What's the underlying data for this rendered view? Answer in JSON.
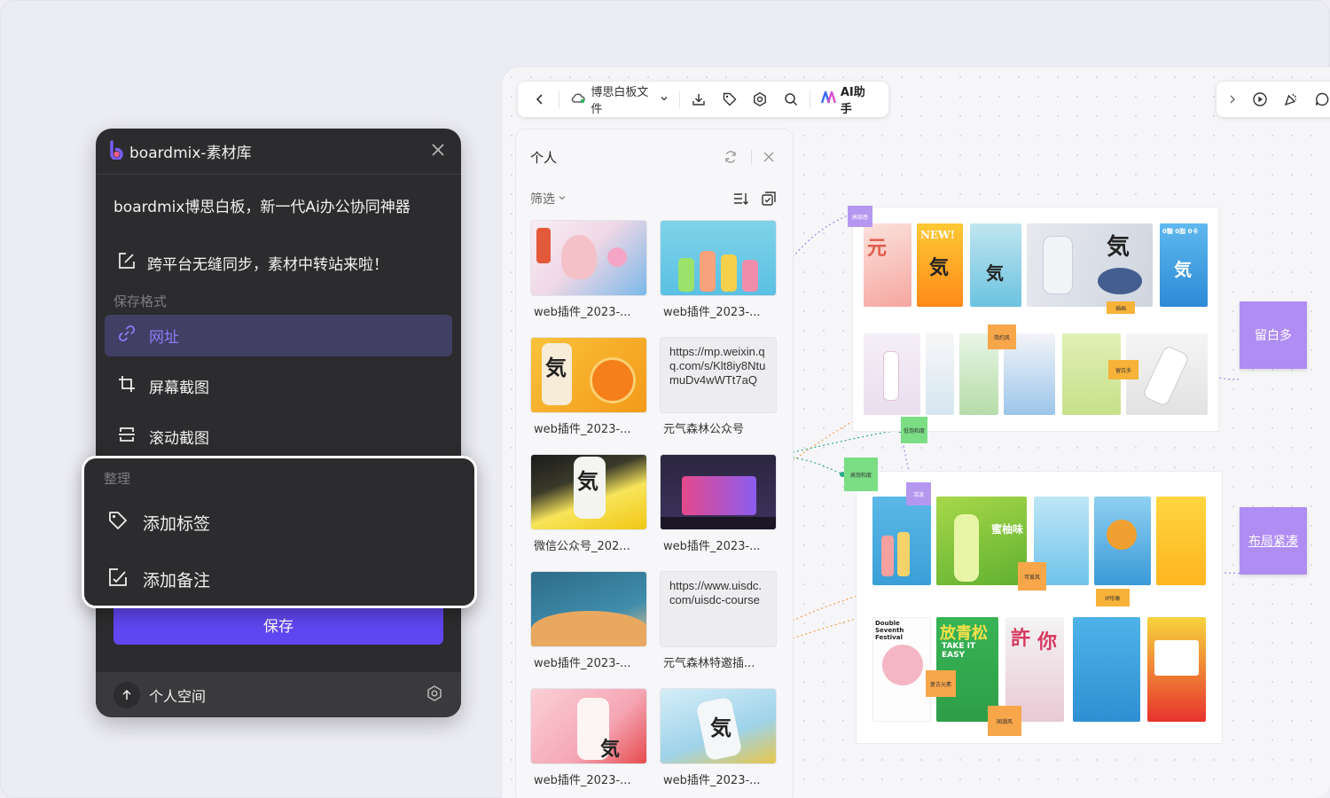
{
  "toolbar": {
    "file_name": "博思白板文件",
    "ai_label": "AI助手"
  },
  "personal_panel": {
    "title": "个人",
    "filter_label": "筛选",
    "cards": [
      {
        "label": "web插件_2023-...",
        "type": "image",
        "colors": [
          "#f4e6ef",
          "#7bb8e8"
        ]
      },
      {
        "label": "web插件_2023-...",
        "type": "image",
        "colors": [
          "#7fd3e9",
          "#f7c0a0"
        ]
      },
      {
        "label": "web插件_2023-...",
        "type": "image",
        "colors": [
          "#f3b233",
          "#f7e6c9"
        ]
      },
      {
        "label": "元气森林公众号",
        "type": "url",
        "url_text": "https://mp.weixin.qq.com/s/Klt8iy8NtumuDv4wWTt7aQ"
      },
      {
        "label": "微信公众号_202...",
        "type": "image",
        "colors": [
          "#f7e55a",
          "#1c1c1c"
        ]
      },
      {
        "label": "web插件_2023-...",
        "type": "image",
        "colors": [
          "#2a2540",
          "#e6498c"
        ]
      },
      {
        "label": "web插件_2023-...",
        "type": "image",
        "colors": [
          "#2e6c8a",
          "#f0c48a"
        ]
      },
      {
        "label": "元气森林特邀插...",
        "type": "url",
        "url_text": "https://www.uisdc.com/uisdc-course"
      },
      {
        "label": "web插件_2023-...",
        "type": "image",
        "colors": [
          "#f5a6b5",
          "#e54b4b"
        ]
      },
      {
        "label": "web插件_2023-...",
        "type": "image",
        "colors": [
          "#bfe4f2",
          "#e8c74a"
        ]
      }
    ]
  },
  "material": {
    "title": "boardmix-素材库",
    "subtitle": "boardmix博思白板，新一代Ai办公协同神器",
    "sync_text": "跨平台无缝同步，素材中转站来啦！",
    "save_format_label": "保存格式",
    "formats": [
      {
        "label": "网址",
        "icon": "link-icon",
        "active": true
      },
      {
        "label": "屏幕截图",
        "icon": "crop-icon",
        "active": false
      },
      {
        "label": "滚动截图",
        "icon": "scroll-capture-icon",
        "active": false
      }
    ],
    "organize_label": "整理",
    "organize_items": [
      {
        "label": "添加标签",
        "icon": "tag-icon"
      },
      {
        "label": "添加备注",
        "icon": "note-icon"
      }
    ],
    "save_label": "保存",
    "footer_label": "个人空间"
  },
  "board": {
    "side_notes": [
      "留白多",
      "布局紧凑"
    ],
    "stickies": [
      "高级感",
      "插画",
      "简约风",
      "留白多",
      "低饱和度",
      "高饱和度",
      "活泼",
      "可爱风",
      "IP形象",
      "复古元素",
      "国潮风"
    ],
    "poster_text": {
      "new": "NEW!",
      "qi": "気",
      "zero": "0糖 0脂 0卡",
      "fangqingsong": "放青松",
      "take_easy": "TAKE IT EASY",
      "double_seventh": "Double Seventh Festival",
      "mitao": "蜜柚味",
      "xu": "許",
      "ni": "你"
    },
    "accent": "#6046f0",
    "note_color": "#b08df2"
  }
}
